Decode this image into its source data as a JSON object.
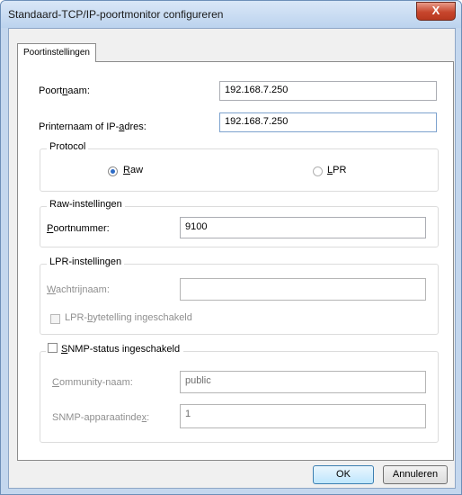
{
  "window": {
    "title": "Standaard-TCP/IP-poortmonitor configureren",
    "close_glyph": "X"
  },
  "tab": {
    "label": "Poortinstellingen"
  },
  "port_name": {
    "label_pre": "Poort",
    "label_key": "n",
    "label_post": "aam:",
    "value": "192.168.7.250"
  },
  "printer_name": {
    "label_pre": "Printernaam of IP-",
    "label_key": "a",
    "label_post": "dres:",
    "value": "192.168.7.250"
  },
  "protocol": {
    "legend": "Protocol",
    "raw": {
      "label_key": "R",
      "label_rest": "aw",
      "selected": true
    },
    "lpr": {
      "label_key": "L",
      "label_rest": "PR",
      "selected": false
    }
  },
  "raw_settings": {
    "legend": "Raw-instellingen",
    "port_number": {
      "label_key": "P",
      "label_rest": "oortnummer:",
      "value": "9100"
    }
  },
  "lpr_settings": {
    "legend": "LPR-instellingen",
    "queue_name": {
      "label_key": "W",
      "label_rest": "achtrijnaam:",
      "value": ""
    },
    "byte_counting": {
      "label_pre": "LPR-",
      "label_key": "b",
      "label_post": "ytetelling ingeschakeld",
      "checked": false
    }
  },
  "snmp": {
    "enabled": {
      "label_key": "S",
      "label_rest": "NMP-status ingeschakeld",
      "checked": false
    },
    "community": {
      "label_key": "C",
      "label_rest": "ommunity-naam:",
      "value": "public"
    },
    "device_index": {
      "label_pre": "SNMP-apparaatinde",
      "label_key": "x",
      "label_post": ":",
      "value": "1"
    }
  },
  "buttons": {
    "ok": "OK",
    "cancel": "Annuleren"
  }
}
